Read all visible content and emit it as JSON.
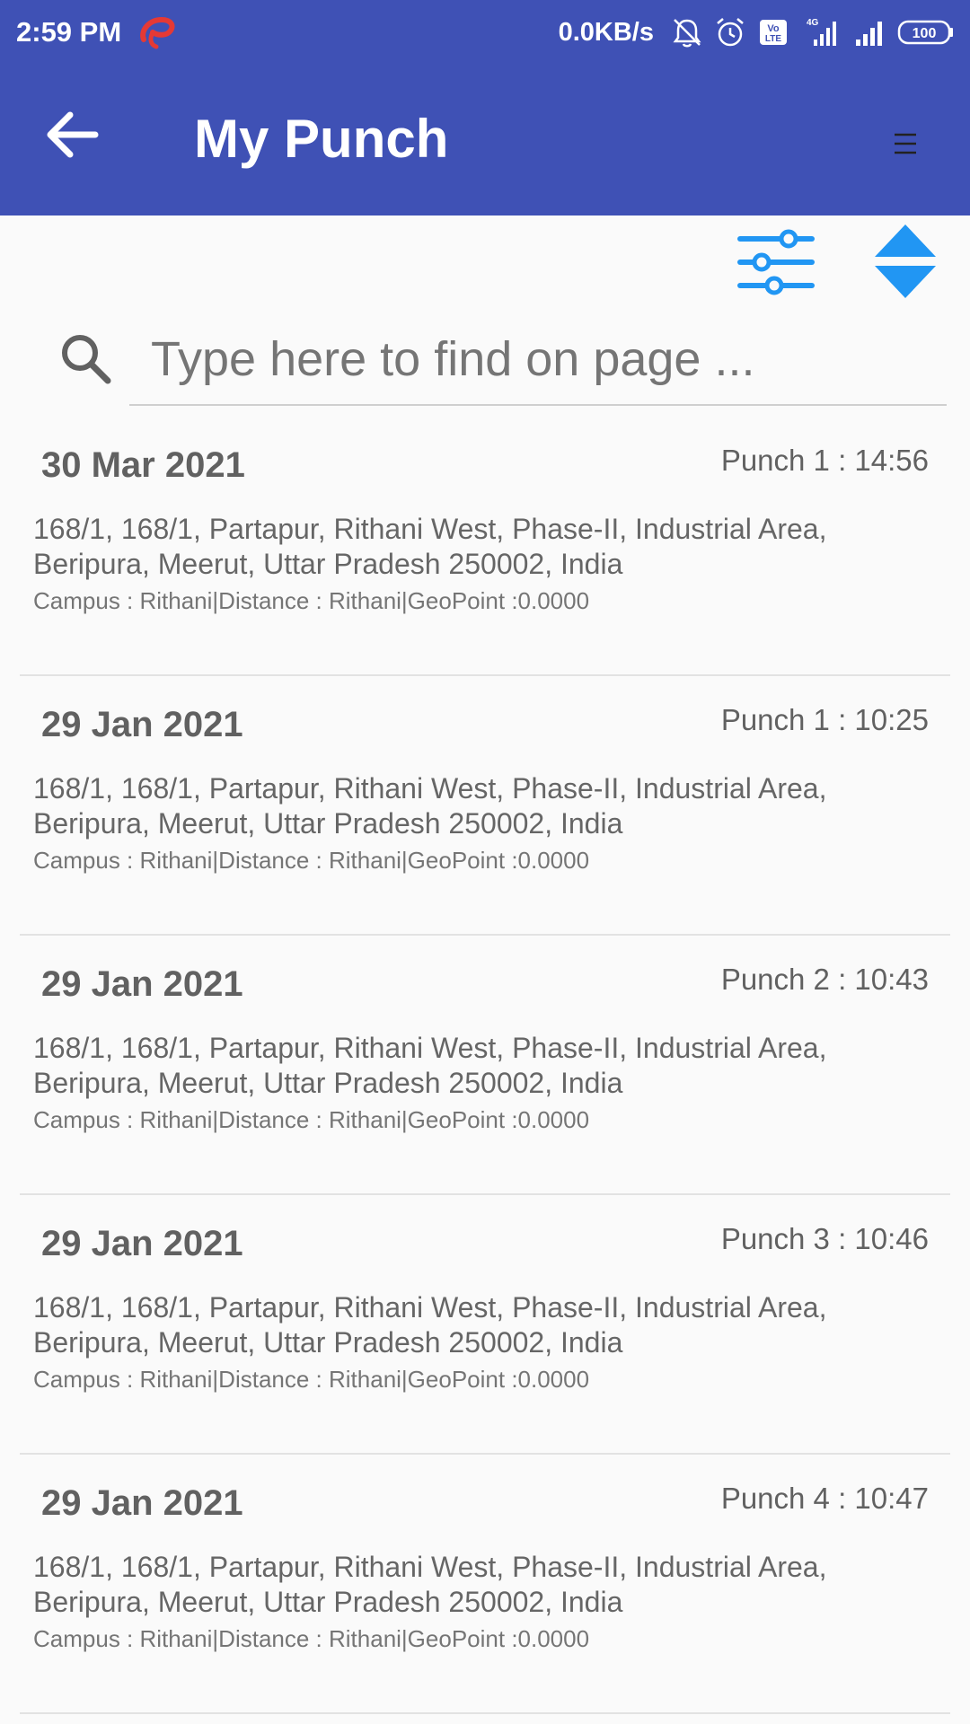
{
  "status_bar": {
    "time": "2:59 PM",
    "network_speed": "0.0KB/s",
    "battery": "100",
    "icons": [
      "airtel-logo-icon",
      "bell-off-icon",
      "alarm-icon",
      "volte-icon",
      "signal-4g-icon",
      "signal-icon",
      "battery-icon"
    ]
  },
  "app_bar": {
    "title": "My Punch",
    "back_icon": "arrow-left-icon",
    "menu_icon": "menu-icon",
    "color": "#3f51b5"
  },
  "toolbar": {
    "filter_icon": "sliders-icon",
    "sort_icon": "sort-up-down-icon",
    "accent": "#2196f3"
  },
  "search": {
    "placeholder": "Type here to find on page ...",
    "value": ""
  },
  "punches": [
    {
      "date": "30 Mar 2021",
      "punch": "Punch 1 : 14:56",
      "address": "168/1, 168/1, Partapur, Rithani West, Phase-II, Industrial Area, Beripura, Meerut, Uttar Pradesh 250002, India",
      "meta": "Campus : Rithani|Distance : Rithani|GeoPoint :0.0000"
    },
    {
      "date": "29 Jan 2021",
      "punch": "Punch 1 : 10:25",
      "address": "168/1, 168/1, Partapur, Rithani West, Phase-II, Industrial Area, Beripura, Meerut, Uttar Pradesh 250002, India",
      "meta": "Campus : Rithani|Distance : Rithani|GeoPoint :0.0000"
    },
    {
      "date": "29 Jan 2021",
      "punch": "Punch 2 : 10:43",
      "address": "168/1, 168/1, Partapur, Rithani West, Phase-II, Industrial Area, Beripura, Meerut, Uttar Pradesh 250002, India",
      "meta": "Campus : Rithani|Distance : Rithani|GeoPoint :0.0000"
    },
    {
      "date": "29 Jan 2021",
      "punch": "Punch 3 : 10:46",
      "address": "168/1, 168/1, Partapur, Rithani West, Phase-II, Industrial Area, Beripura, Meerut, Uttar Pradesh 250002, India",
      "meta": "Campus : Rithani|Distance : Rithani|GeoPoint :0.0000"
    },
    {
      "date": "29 Jan 2021",
      "punch": "Punch 4 : 10:47",
      "address": "168/1, 168/1, Partapur, Rithani West, Phase-II, Industrial Area, Beripura, Meerut, Uttar Pradesh 250002, India",
      "meta": "Campus : Rithani|Distance : Rithani|GeoPoint :0.0000"
    }
  ]
}
